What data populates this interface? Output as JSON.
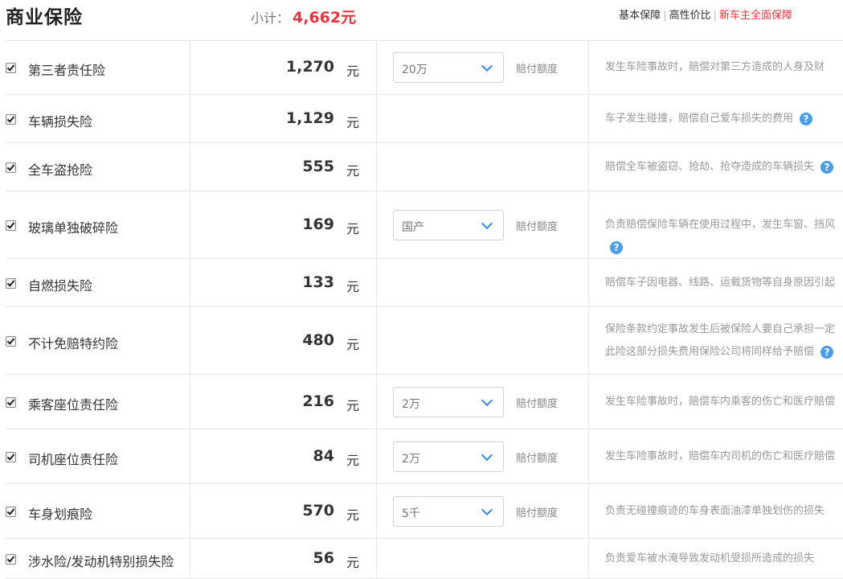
{
  "header": {
    "title": "商业保险",
    "subtotal_label": "小计：",
    "subtotal_value": "4,662元",
    "tabs": [
      "基本保障",
      "高性价比",
      "新车主全面保障"
    ]
  },
  "rows": [
    {
      "name": "第三者责任险",
      "price": "1,270",
      "unit": "元",
      "option": "20万",
      "option_label": "赔付额度",
      "desc": [
        "发生车险事故时，赔偿对第三方造成的人身及财"
      ]
    },
    {
      "name": "车辆损失险",
      "price": "1,129",
      "unit": "元",
      "option": null,
      "option_label": null,
      "desc": [
        "车子发生碰撞，赔偿自己爱车损失的费用"
      ],
      "help": "?"
    },
    {
      "name": "全车盗抢险",
      "price": "555",
      "unit": "元",
      "option": null,
      "option_label": null,
      "desc": [
        "赔偿全车被盗窃、抢劫、抢夺造成的车辆损失"
      ],
      "help": "?"
    },
    {
      "name": "玻璃单独破碎险",
      "price": "169",
      "unit": "元",
      "option": "国产",
      "option_label": "赔付额度",
      "desc": [
        "负责赔偿保险车辆在使用过程中，发生车窗、挡风"
      ],
      "help_line2": "?"
    },
    {
      "name": "自燃损失险",
      "price": "133",
      "unit": "元",
      "option": null,
      "option_label": null,
      "desc": [
        "赔偿车子因电器、线路、运载货物等自身原因引起"
      ]
    },
    {
      "name": "不计免赔特约险",
      "price": "480",
      "unit": "元",
      "option": null,
      "option_label": null,
      "desc": [
        "保险条款约定事故发生后被保险人要自己承担一定",
        "此险这部分损失费用保险公司将同样给予赔偿"
      ],
      "help": "?"
    },
    {
      "name": "乘客座位责任险",
      "price": "216",
      "unit": "元",
      "option": "2万",
      "option_label": "赔付额度",
      "desc": [
        "发生车险事故时，赔偿车内乘客的伤亡和医疗赔偿"
      ]
    },
    {
      "name": "司机座位责任险",
      "price": "84",
      "unit": "元",
      "option": "2万",
      "option_label": "赔付额度",
      "desc": [
        "发生车险事故时，赔偿车内司机的伤亡和医疗赔偿"
      ]
    },
    {
      "name": "车身划痕险",
      "price": "570",
      "unit": "元",
      "option": "5千",
      "option_label": "赔付额度",
      "desc": [
        "负责无碰撞痕迹的车身表面油漆单独划伤的损失"
      ]
    },
    {
      "name": "涉水险/发动机特别损失险",
      "price": "56",
      "unit": "元",
      "option": null,
      "option_label": null,
      "desc": [
        "负责爱车被水淹导致发动机受损所造成的损失"
      ]
    }
  ]
}
